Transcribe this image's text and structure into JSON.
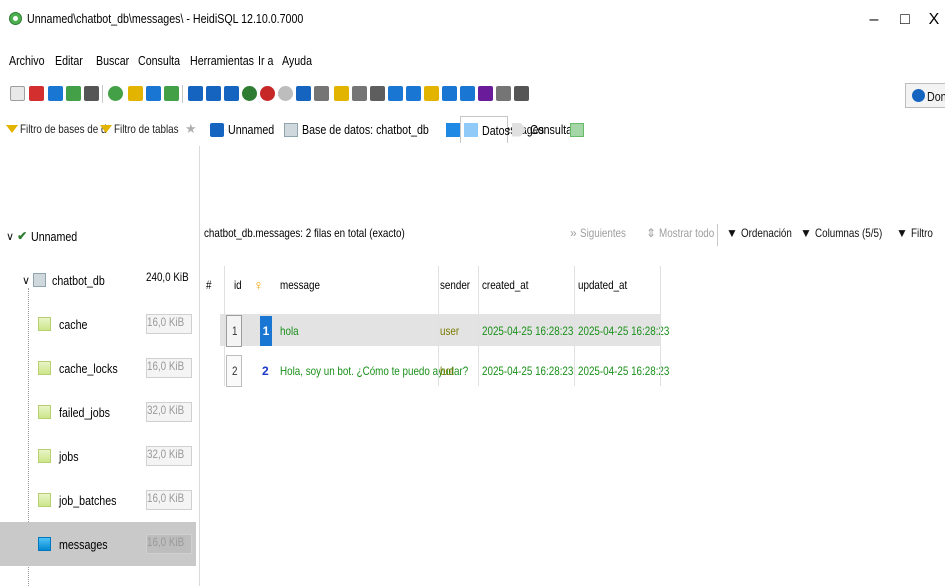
{
  "window": {
    "title": "Unnamed\\chatbot_db\\messages\\ - HeidiSQL 12.10.0.7000",
    "minimize": "–",
    "maximize": "□",
    "close": "X"
  },
  "menu": [
    "Archivo",
    "Editar",
    "Buscar",
    "Consulta",
    "Herramientas",
    "Ir a",
    "Ayuda"
  ],
  "toolbar": {
    "donate_label": "Don"
  },
  "filters": {
    "db_filter": "Filtro de bases de d",
    "table_filter": "Filtro de tablas"
  },
  "tabs": [
    {
      "label": "Unnamed",
      "icon": "server-icon"
    },
    {
      "label": "Base de datos: chatbot_db",
      "icon": "database-icon"
    },
    {
      "label": "Tabla: messages",
      "icon": "table-icon"
    },
    {
      "label": "Datos",
      "icon": "grid-icon",
      "active": true
    },
    {
      "label": "Consulta*",
      "icon": "query-icon"
    }
  ],
  "tree": {
    "root": "Unnamed",
    "db": {
      "name": "chatbot_db",
      "size": "240,0 KiB"
    },
    "tables": [
      {
        "name": "cache",
        "size": "16,0 KiB"
      },
      {
        "name": "cache_locks",
        "size": "16,0 KiB"
      },
      {
        "name": "failed_jobs",
        "size": "32,0 KiB"
      },
      {
        "name": "jobs",
        "size": "32,0 KiB"
      },
      {
        "name": "job_batches",
        "size": "16,0 KiB"
      },
      {
        "name": "messages",
        "size": "16,0 KiB"
      }
    ]
  },
  "data": {
    "row_count": "chatbot_db.messages: 2 filas en total (exacto)",
    "next": "Siguientes",
    "show_all": "Mostrar todo",
    "sort": "Ordenación",
    "columns": "Columnas (5/5)",
    "filter": "Filtro",
    "headers": [
      "#",
      "id",
      "message",
      "sender",
      "created_at",
      "updated_at"
    ],
    "rows": [
      {
        "num": "1",
        "id": "1",
        "message": "hola",
        "sender": "user",
        "created_at": "2025-04-25 16:28:23",
        "updated_at": "2025-04-25 16:28:23"
      },
      {
        "num": "2",
        "id": "2",
        "message": "Hola, soy un bot. ¿Cómo te puedo ayudar?",
        "sender": "bot",
        "created_at": "2025-04-25 16:28:23",
        "updated_at": "2025-04-25 16:28:23"
      }
    ]
  },
  "colors": {
    "text_green": "#1a8f1a",
    "id_blue": "#1a36c7",
    "sender_olive": "#7a7a00",
    "selected_row": "#e3e3e3",
    "key_icon": "#f0a000"
  }
}
